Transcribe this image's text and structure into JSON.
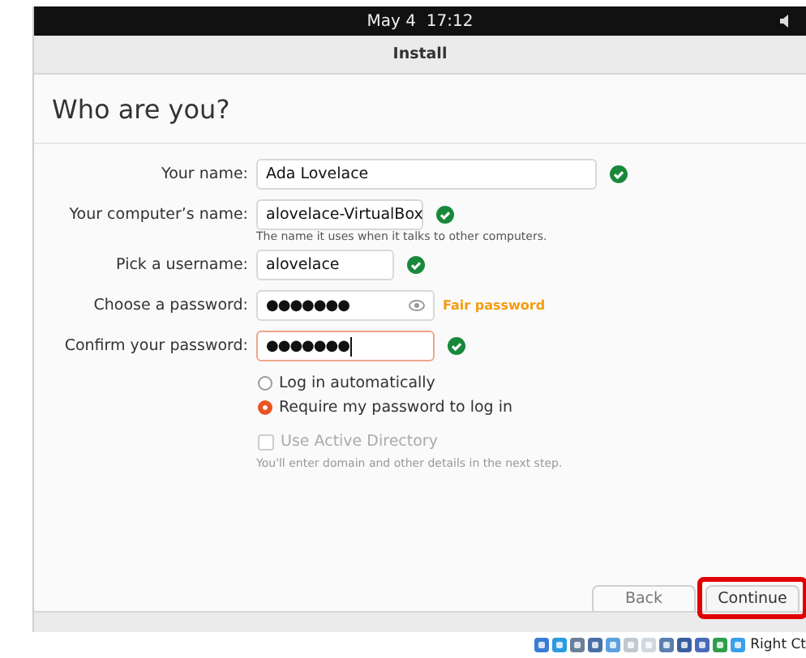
{
  "top_bar": {
    "clock": "May 4  17:12"
  },
  "window": {
    "title": "Install"
  },
  "page": {
    "heading": "Who are you?"
  },
  "fields": [
    {
      "kind": "text",
      "label": "Your name:",
      "value": "Ada Lovelace",
      "valid": true,
      "focused": false
    },
    {
      "kind": "text",
      "label": "Your computer’s name:",
      "value": "alovelace-VirtualBox",
      "valid": true,
      "focused": false,
      "hint": "The name it uses when it talks to other computers."
    },
    {
      "kind": "text",
      "label": "Pick a username:",
      "value": "alovelace",
      "valid": true,
      "focused": false
    },
    {
      "kind": "password",
      "label": "Choose a password:",
      "value": "●●●●●●●",
      "valid": false,
      "focused": false,
      "strength": "Fair password"
    },
    {
      "kind": "password",
      "label": "Confirm your password:",
      "value": "●●●●●●●",
      "valid": true,
      "focused": true
    }
  ],
  "login_options": [
    {
      "label": "Log in automatically",
      "selected": false
    },
    {
      "label": "Require my password to log in",
      "selected": true
    }
  ],
  "active_directory": {
    "label": "Use Active Directory",
    "checked": false,
    "disabled": true,
    "hint": "You'll enter domain and other details in the next step."
  },
  "buttons": [
    {
      "label": "Back",
      "kind": "secondary",
      "highlighted": false
    },
    {
      "label": "Continue",
      "kind": "primary",
      "highlighted": true
    }
  ],
  "status_bar": {
    "text": "Right Ct"
  }
}
